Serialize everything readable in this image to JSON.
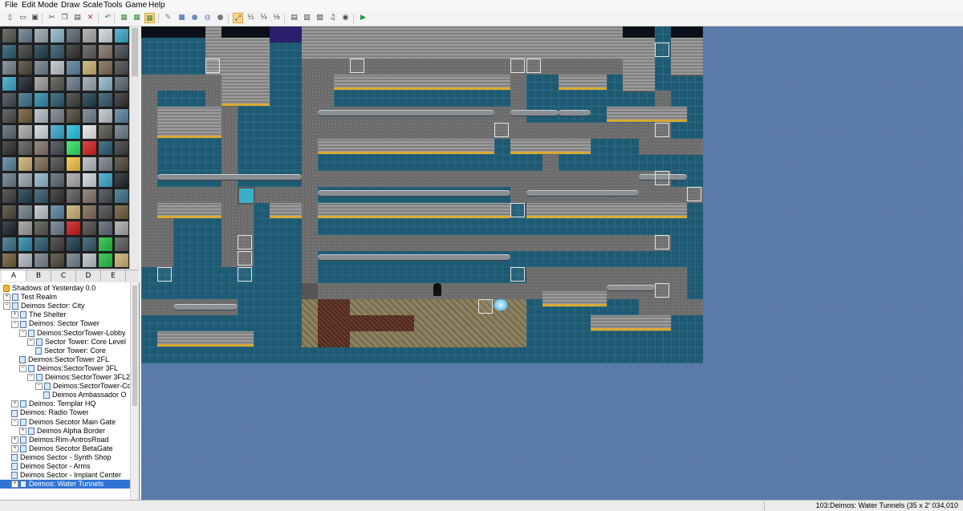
{
  "menu": [
    "File",
    "Edit",
    "Mode",
    "Draw",
    "Scale",
    "Tools",
    "Game",
    "Help"
  ],
  "toolbar": {
    "icons": [
      "new-project-icon",
      "open-project-icon",
      "save-project-icon",
      "cut-icon",
      "copy-icon",
      "paste-icon",
      "delete-icon",
      "undo-icon",
      "layer1-icon",
      "layer2-icon",
      "layer3-icon",
      "pencil-icon",
      "rectangle-icon",
      "ellipse-icon",
      "fill-icon",
      "shadow-icon",
      "zoom-1-1-icon",
      "zoom-1-2-icon",
      "zoom-1-4-icon",
      "zoom-1-8-icon",
      "database-icon",
      "material-icon",
      "script-editor-icon",
      "sound-test-icon",
      "options-icon",
      "playtest-icon"
    ],
    "active": [
      "layer3-icon",
      "zoom-1-1-icon"
    ]
  },
  "tileset_tabs": [
    "A",
    "B",
    "C",
    "D",
    "E"
  ],
  "active_tab": "A",
  "map_tree": [
    {
      "label": "Shadows of Yesterday 0.0",
      "depth": 0,
      "expander": "",
      "type": "game"
    },
    {
      "label": "Test Realm",
      "depth": 0,
      "expander": "+",
      "type": "map"
    },
    {
      "label": "Deimos Sector: City",
      "depth": 0,
      "expander": "-",
      "type": "map"
    },
    {
      "label": "The Shelter",
      "depth": 1,
      "expander": "+",
      "type": "map"
    },
    {
      "label": "Deimos: Sector Tower",
      "depth": 1,
      "expander": "-",
      "type": "map"
    },
    {
      "label": "Deimos:SectorTower-Lobby",
      "depth": 2,
      "expander": "-",
      "type": "map"
    },
    {
      "label": "Sector Tower: Core Level",
      "depth": 3,
      "expander": "-",
      "type": "map"
    },
    {
      "label": "Sector Tower: Core",
      "depth": 4,
      "expander": "",
      "type": "map"
    },
    {
      "label": "Deimos:SectorTower 2FL",
      "depth": 2,
      "expander": "",
      "type": "map"
    },
    {
      "label": "Deimos:SectorTower 3FL",
      "depth": 2,
      "expander": "-",
      "type": "map"
    },
    {
      "label": "Deimos:SectorTower 3FL2",
      "depth": 3,
      "expander": "-",
      "type": "map"
    },
    {
      "label": "Deimos:SectorTower-Cou",
      "depth": 4,
      "expander": "-",
      "type": "map"
    },
    {
      "label": "Deimos Ambassador O",
      "depth": 5,
      "expander": "",
      "type": "map"
    },
    {
      "label": "Deimos: Templar HQ",
      "depth": 1,
      "expander": "+",
      "type": "map"
    },
    {
      "label": "Deimos: Radio Tower",
      "depth": 1,
      "expander": "",
      "type": "map"
    },
    {
      "label": "Deimos Secotor Main Gate",
      "depth": 1,
      "expander": "-",
      "type": "map"
    },
    {
      "label": "Deimos Alpha Border",
      "depth": 2,
      "expander": "+",
      "type": "map"
    },
    {
      "label": "Deimos:Rim-AntrosRoad",
      "depth": 1,
      "expander": "+",
      "type": "map"
    },
    {
      "label": "Deimos Secotor BetaGate",
      "depth": 1,
      "expander": "+",
      "type": "map"
    },
    {
      "label": "Deimos Sector - Synth Shop",
      "depth": 1,
      "expander": "",
      "type": "map"
    },
    {
      "label": "Deimos Sector - Arms",
      "depth": 1,
      "expander": "",
      "type": "map"
    },
    {
      "label": "Deimos Sector - Implant Center",
      "depth": 1,
      "expander": "",
      "type": "map"
    },
    {
      "label": "Deimos: Water Tunnels",
      "depth": 1,
      "expander": "+",
      "type": "map",
      "selected": true
    }
  ],
  "status": {
    "map_info": "103:Deimos: Water Tunnels (35 x 2",
    "coords": "034,010"
  }
}
